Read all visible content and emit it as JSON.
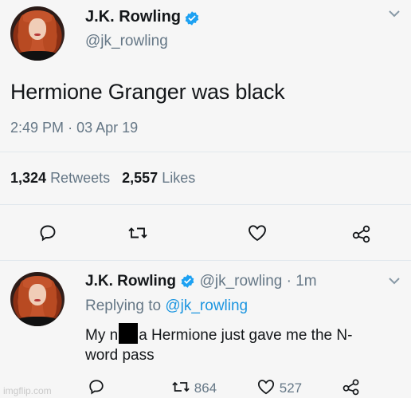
{
  "tweet": {
    "display_name": "J.K. Rowling",
    "handle": "@jk_rowling",
    "text": "Hermione Granger was black",
    "time": "2:49 PM",
    "dot": "·",
    "date": "03 Apr 19",
    "retweets_count": "1,324",
    "retweets_label": "Retweets",
    "likes_count": "2,557",
    "likes_label": "Likes"
  },
  "reply": {
    "display_name": "J.K. Rowling",
    "handle": "@jk_rowling",
    "dot": "·",
    "age": "1m",
    "replying_prefix": "Replying to",
    "replying_handle": "@jk_rowling",
    "text_before": "My n",
    "text_after": "a Hermione just gave me the N-",
    "text_line2": "word pass",
    "retweets_count": "864",
    "likes_count": "527"
  },
  "watermark": "imgflip.com",
  "colors": {
    "verified": "#1da1f2",
    "link": "#1b95e0",
    "muted": "#657786"
  },
  "icons": [
    "verified-badge-icon",
    "chevron-down-icon",
    "reply-icon",
    "retweet-icon",
    "like-icon",
    "share-icon"
  ]
}
